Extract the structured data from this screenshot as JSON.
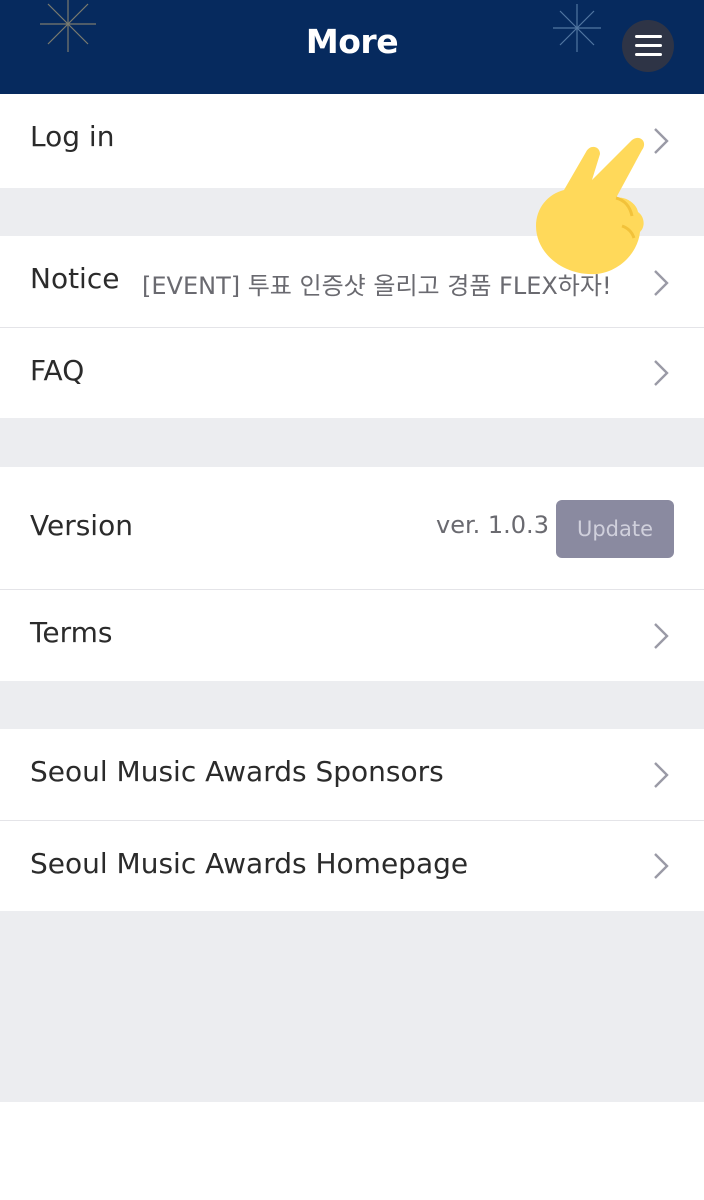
{
  "header": {
    "title": "More",
    "menu_icon": "hamburger-menu-icon",
    "background": "#062a5e"
  },
  "sections": {
    "login": {
      "label": "Log in"
    },
    "notice": {
      "label": "Notice",
      "latest": "[EVENT] 투표 인증샷 올리고 경품 FLEX하자!"
    },
    "faq": {
      "label": "FAQ"
    },
    "version": {
      "label": "Version",
      "value": "ver. 1.0.3",
      "update_label": "Update"
    },
    "terms": {
      "label": "Terms"
    },
    "sponsors": {
      "label": "Seoul Music Awards Sponsors"
    },
    "homepage": {
      "label": "Seoul Music Awards Homepage"
    }
  },
  "overlay": {
    "emoji": "pointing-hand-emoji"
  },
  "colors": {
    "gap": "#ecedf0",
    "update_button": "#8a8aa0"
  }
}
